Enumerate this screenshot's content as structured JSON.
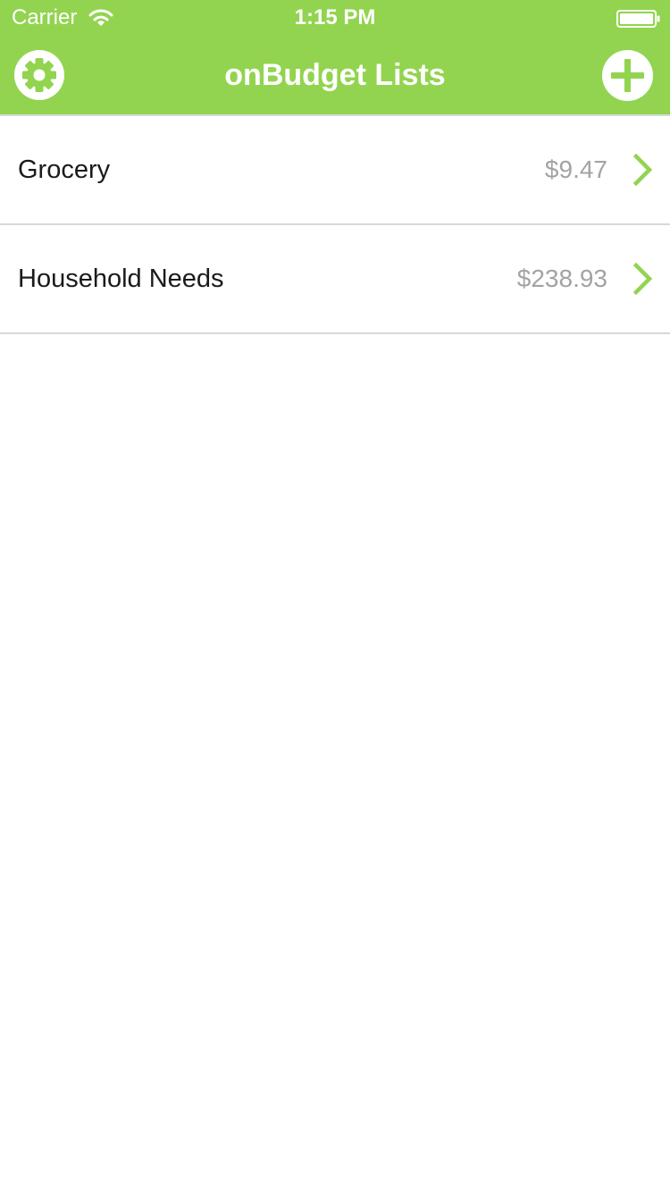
{
  "status_bar": {
    "carrier": "Carrier",
    "time": "1:15 PM"
  },
  "nav": {
    "title": "onBudget Lists",
    "left_icon": "gear-icon",
    "right_icon": "plus-icon"
  },
  "lists": [
    {
      "name": "Grocery",
      "amount": "$9.47"
    },
    {
      "name": "Household Needs",
      "amount": "$238.93"
    }
  ],
  "colors": {
    "accent": "#92d44f",
    "amount_text": "#a3a3a3",
    "separator": "#d8d8d8"
  }
}
